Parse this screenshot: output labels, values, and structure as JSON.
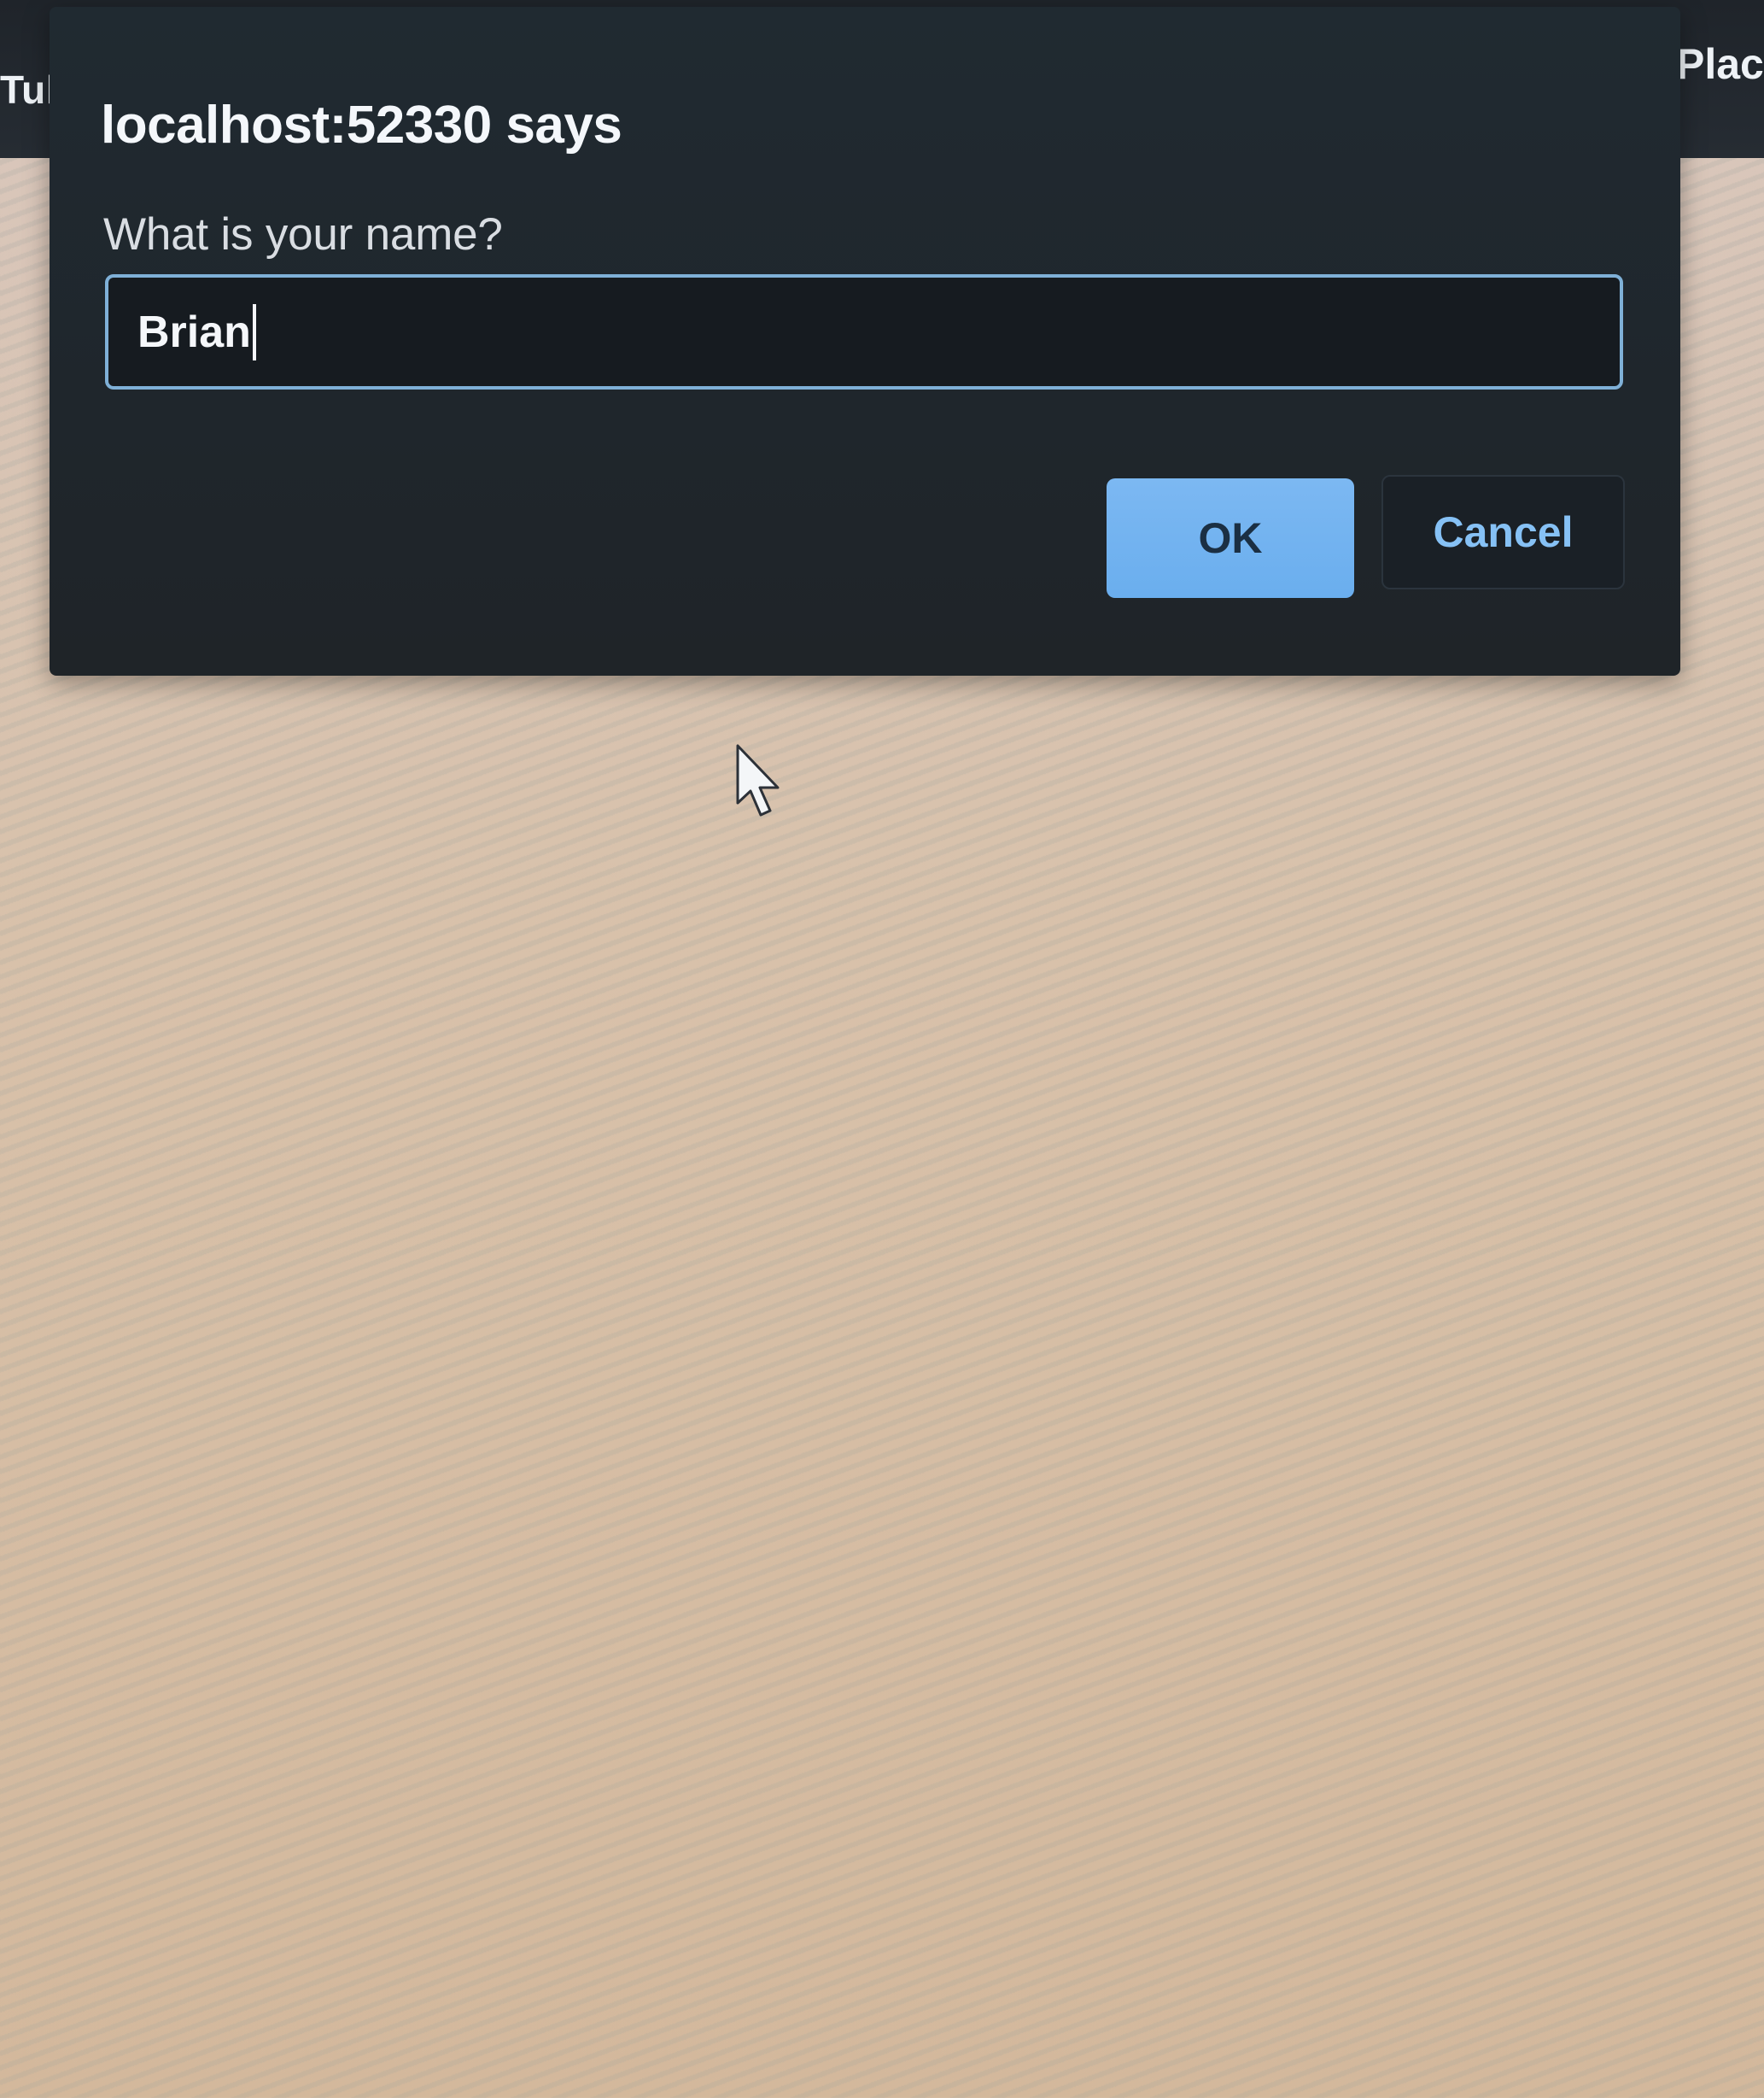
{
  "background_tab": {
    "left_text": "Tul",
    "right_text": "Place"
  },
  "dialog": {
    "title": "localhost:52330 says",
    "message": "What is your name?",
    "input_value": "Brian",
    "ok_label": "OK",
    "cancel_label": "Cancel"
  },
  "icons": {
    "cursor": "mouse-pointer-icon"
  },
  "colors": {
    "dialog_bg": "#202830",
    "accent_ok": "#6aaeee",
    "input_border": "#7fb0d7",
    "cancel_text": "#86c1f5"
  }
}
